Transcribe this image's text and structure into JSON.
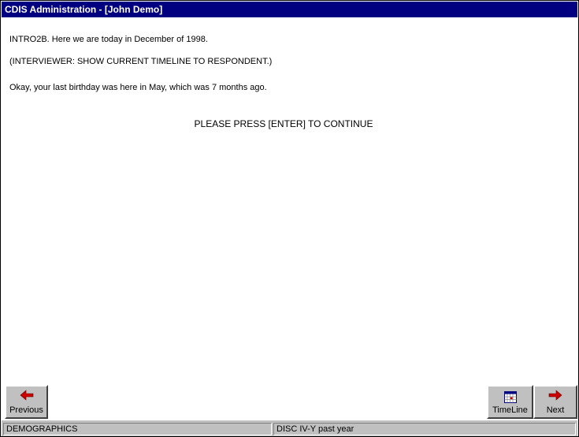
{
  "window": {
    "title": "CDIS Administration - [John Demo]"
  },
  "content": {
    "line1": "INTRO2B. Here we are today in December of 1998.",
    "line2": "(INTERVIEWER: SHOW CURRENT TIMELINE TO RESPONDENT.)",
    "line3": "Okay, your last birthday was here in May, which was 7 months ago.",
    "prompt": "PLEASE PRESS [ENTER] TO CONTINUE"
  },
  "buttons": {
    "previous": {
      "label": "Previous",
      "icon": "arrow-left-icon"
    },
    "timeline": {
      "label": "TimeLine",
      "icon": "calendar-icon"
    },
    "next": {
      "label": "Next",
      "icon": "arrow-right-icon"
    }
  },
  "status": {
    "section": "DEMOGRAPHICS",
    "instrument": "DISC IV-Y past year"
  },
  "colors": {
    "titlebar": "#000080",
    "face": "#c0c0c0",
    "arrow": "#cc0000"
  }
}
